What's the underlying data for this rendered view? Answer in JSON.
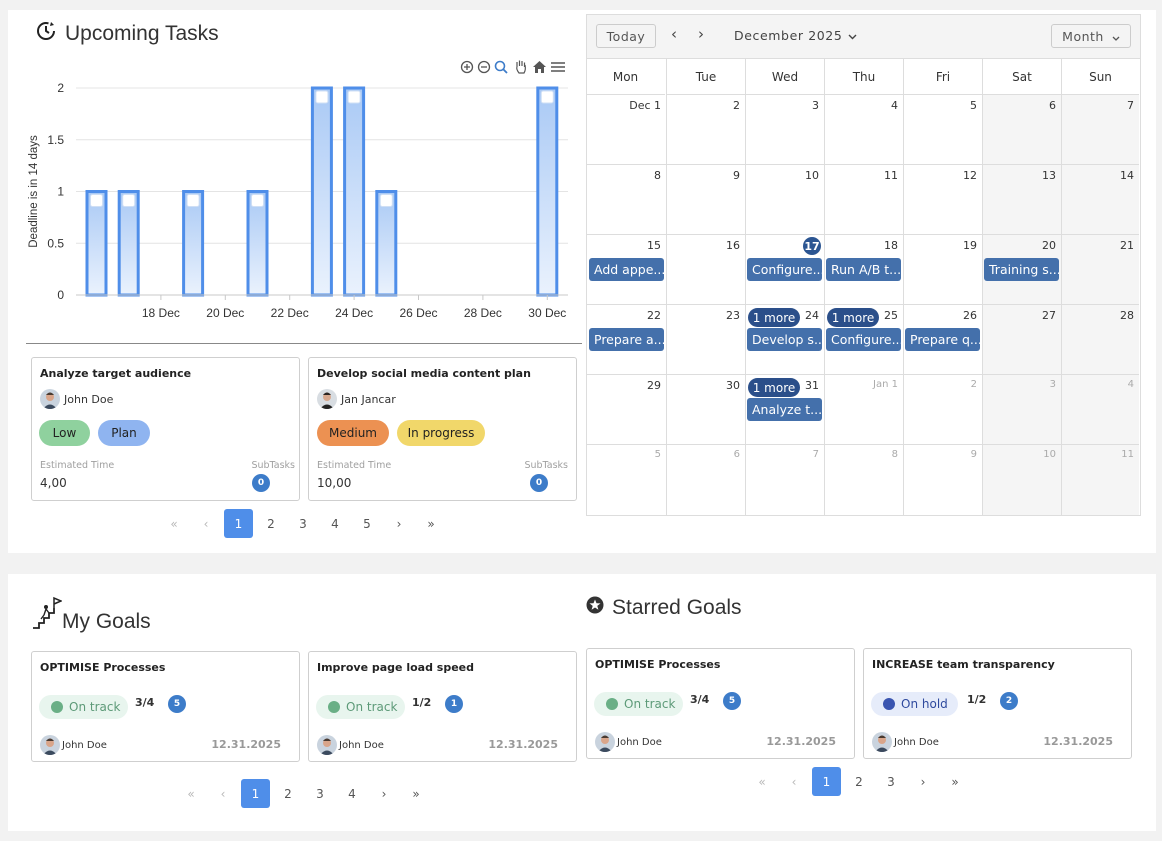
{
  "upcoming": {
    "title": "Upcoming Tasks",
    "toolbar_icons": [
      "zoom-in-icon",
      "zoom-out-icon",
      "magnify-icon",
      "pan-hand-icon",
      "home-icon",
      "menu-icon"
    ]
  },
  "chart_data": {
    "type": "bar",
    "ylabel": "Deadline is in 14 days",
    "ylim": [
      0,
      2
    ],
    "yticks": [
      "2",
      "1.5",
      "1",
      "0.5",
      "0"
    ],
    "xticks": [
      "18 Dec",
      "20 Dec",
      "22 Dec",
      "24 Dec",
      "26 Dec",
      "28 Dec",
      "30 Dec"
    ],
    "categories": [
      "16 Dec",
      "17 Dec",
      "18 Dec",
      "19 Dec",
      "20 Dec",
      "21 Dec",
      "22 Dec",
      "23 Dec",
      "24 Dec",
      "25 Dec",
      "26 Dec",
      "27 Dec",
      "28 Dec",
      "29 Dec",
      "30 Dec",
      "31 Dec"
    ],
    "values": [
      1,
      1,
      0,
      1,
      0,
      1,
      0,
      2,
      2,
      1,
      0,
      0,
      0,
      0,
      2,
      0
    ],
    "bar_color": "#4f8ee9"
  },
  "tasks": [
    {
      "title": "Analyze target audience",
      "assignee": "John Doe",
      "priority": "Low",
      "priority_color": "#8fd19e",
      "status": "Plan",
      "status_color": "#8fb4f0",
      "est_label": "Estimated Time",
      "est_value": "4,00",
      "sub_label": "SubTasks",
      "sub_count": "0"
    },
    {
      "title": "Develop social media content plan",
      "assignee": "Jan Jancar",
      "priority": "Medium",
      "priority_color": "#ec9152",
      "status": "In progress",
      "status_color": "#f1d76a",
      "est_label": "Estimated Time",
      "est_value": "10,00",
      "sub_label": "SubTasks",
      "sub_count": "0"
    }
  ],
  "pager_tasks": {
    "first": "«",
    "prev": "‹",
    "pages": [
      "1",
      "2",
      "3",
      "4",
      "5"
    ],
    "next": "›",
    "last": "»"
  },
  "calendar": {
    "today_btn": "Today",
    "prev": "‹",
    "next": "›",
    "month_label": "December 2025",
    "view_btn": "Month",
    "weekdays": [
      "Mon",
      "Tue",
      "Wed",
      "Thu",
      "Fri",
      "Sat",
      "Sun"
    ],
    "weeks": [
      [
        "Dec 1",
        "2",
        "3",
        "4",
        "5",
        "6",
        "7"
      ],
      [
        "8",
        "9",
        "10",
        "11",
        "12",
        "13",
        "14"
      ],
      [
        "15",
        "16",
        "17",
        "18",
        "19",
        "20",
        "21"
      ],
      [
        "22",
        "23",
        "24",
        "25",
        "26",
        "27",
        "28"
      ],
      [
        "29",
        "30",
        "31",
        "Jan 1",
        "2",
        "3",
        "4"
      ],
      [
        "5",
        "6",
        "7",
        "8",
        "9",
        "10",
        "11"
      ]
    ],
    "events": [
      {
        "week": 2,
        "day": 0,
        "label": "Add appe..."
      },
      {
        "week": 2,
        "day": 2,
        "label": "Configure..."
      },
      {
        "week": 2,
        "day": 3,
        "label": "Run A/B t..."
      },
      {
        "week": 2,
        "day": 5,
        "label": "Training s..."
      },
      {
        "week": 3,
        "day": 0,
        "label": "Prepare a..."
      },
      {
        "week": 3,
        "day": 2,
        "label": "Develop s..."
      },
      {
        "week": 3,
        "day": 3,
        "label": "Configure..."
      },
      {
        "week": 3,
        "day": 4,
        "label": "Prepare q..."
      },
      {
        "week": 4,
        "day": 2,
        "label": "Analyze t..."
      }
    ],
    "more": [
      {
        "week": 3,
        "day": 2,
        "label": "1 more"
      },
      {
        "week": 3,
        "day": 3,
        "label": "1 more"
      },
      {
        "week": 4,
        "day": 2,
        "label": "1 more"
      }
    ]
  },
  "my_goals": {
    "title": "My Goals",
    "cards": [
      {
        "title": "OPTIMISE Processes",
        "status": "On track",
        "progress": "3/4",
        "count": "5",
        "owner": "John Doe",
        "date": "12.31.2025"
      },
      {
        "title": "Improve page load speed",
        "status": "On track",
        "progress": "1/2",
        "count": "1",
        "owner": "John Doe",
        "date": "12.31.2025"
      }
    ],
    "pager": {
      "first": "«",
      "prev": "‹",
      "pages": [
        "1",
        "2",
        "3",
        "4"
      ],
      "next": "›",
      "last": "»"
    }
  },
  "starred_goals": {
    "title": "Starred Goals",
    "cards": [
      {
        "title": "OPTIMISE Processes",
        "status": "On track",
        "progress": "3/4",
        "count": "5",
        "owner": "John Doe",
        "date": "12.31.2025"
      },
      {
        "title": "INCREASE team transparency",
        "status": "On hold",
        "progress": "1/2",
        "count": "2",
        "owner": "John Doe",
        "date": "12.31.2025"
      }
    ],
    "pager": {
      "first": "«",
      "prev": "‹",
      "pages": [
        "1",
        "2",
        "3"
      ],
      "next": "›",
      "last": "»"
    }
  },
  "colors": {
    "on_track_bg": "#e8f5ee",
    "on_track_dot": "#6aaf86",
    "on_hold_bg": "#e6ecfa",
    "on_hold_dot": "#3a55b0",
    "badge": "#3d7cc9",
    "accent": "#4f8ee9"
  }
}
